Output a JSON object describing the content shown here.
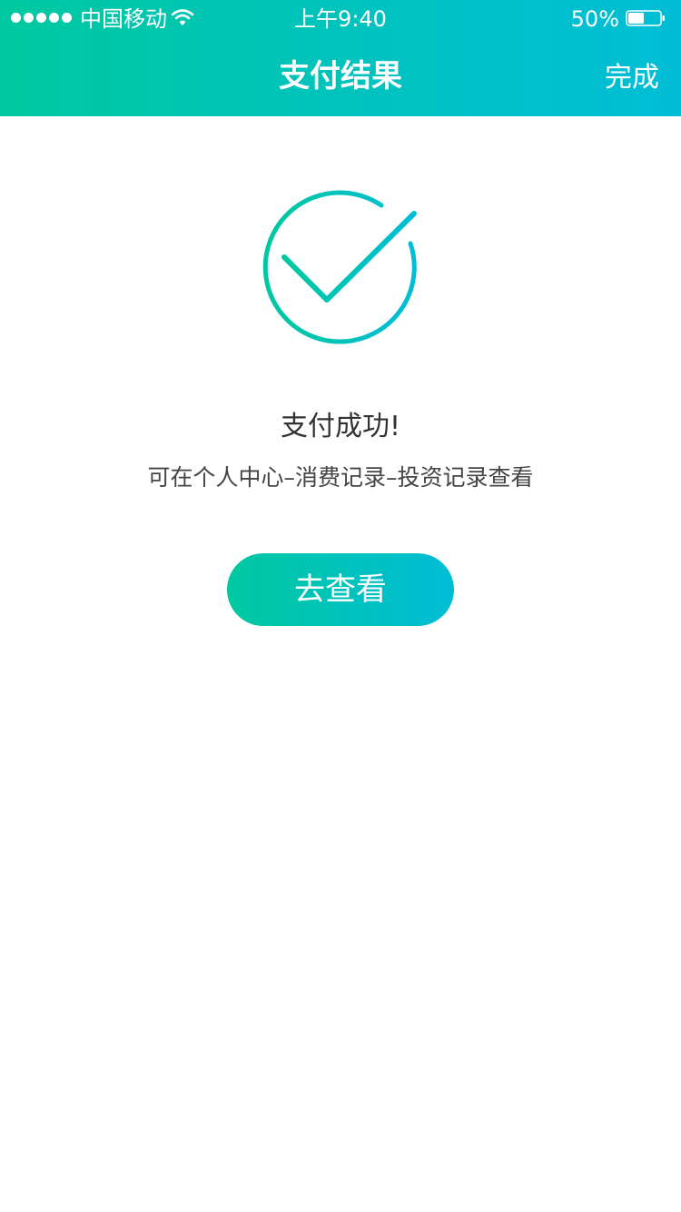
{
  "status_bar": {
    "carrier": "中国移动",
    "time": "上午9:40",
    "battery_percent": "50%",
    "battery_level": 0.5,
    "signal_dots": 5
  },
  "nav": {
    "title": "支付结果",
    "done_label": "完成"
  },
  "result": {
    "icon": "success-check-icon",
    "title": "支付成功!",
    "description": "可在个人中心–消费记录–投资记录查看",
    "button_label": "去查看"
  },
  "colors": {
    "gradient_start": "#00c8a0",
    "gradient_end": "#00bdd6",
    "text_primary": "#333333"
  }
}
